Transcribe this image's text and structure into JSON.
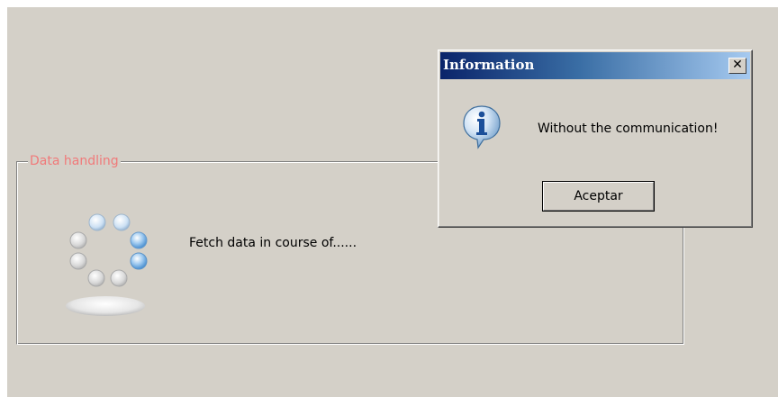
{
  "main": {
    "group_title": "Data handling",
    "status_text": "Fetch data in course of......"
  },
  "dialog": {
    "title": "Information",
    "close_glyph": "✕",
    "message": "Without the communication!",
    "ok_label": "Aceptar",
    "icon": "info-icon"
  },
  "colors": {
    "window_bg": "#d4d0c8",
    "legend_text": "#f07a7a",
    "title_gradient_start": "#0a246a",
    "title_gradient_end": "#a6caf0"
  }
}
